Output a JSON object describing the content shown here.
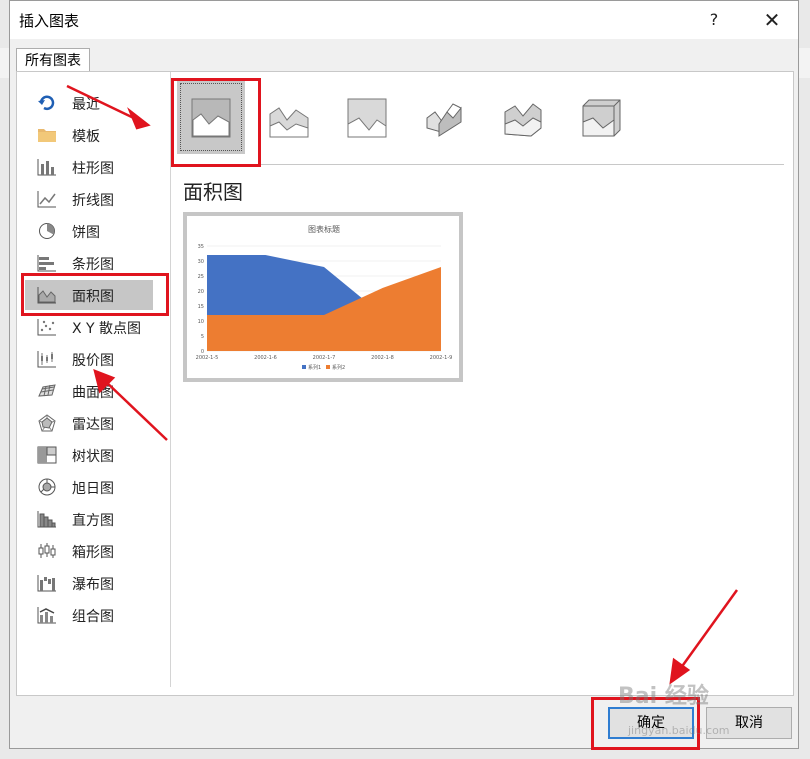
{
  "dialog": {
    "title": "插入图表",
    "help_label": "?",
    "close_label": "✕",
    "tab_label": "所有图表"
  },
  "sidebar": {
    "items": [
      {
        "label": "最近",
        "icon": "recent-icon"
      },
      {
        "label": "模板",
        "icon": "folder-icon"
      },
      {
        "label": "柱形图",
        "icon": "column-chart-icon"
      },
      {
        "label": "折线图",
        "icon": "line-chart-icon"
      },
      {
        "label": "饼图",
        "icon": "pie-chart-icon"
      },
      {
        "label": "条形图",
        "icon": "bar-chart-icon"
      },
      {
        "label": "面积图",
        "icon": "area-chart-icon",
        "selected": true
      },
      {
        "label": "X Y 散点图",
        "icon": "scatter-chart-icon"
      },
      {
        "label": "股价图",
        "icon": "stock-chart-icon"
      },
      {
        "label": "曲面图",
        "icon": "surface-chart-icon"
      },
      {
        "label": "雷达图",
        "icon": "radar-chart-icon"
      },
      {
        "label": "树状图",
        "icon": "treemap-chart-icon"
      },
      {
        "label": "旭日图",
        "icon": "sunburst-chart-icon"
      },
      {
        "label": "直方图",
        "icon": "histogram-chart-icon"
      },
      {
        "label": "箱形图",
        "icon": "box-whisker-chart-icon"
      },
      {
        "label": "瀑布图",
        "icon": "waterfall-chart-icon"
      },
      {
        "label": "组合图",
        "icon": "combo-chart-icon"
      }
    ]
  },
  "subtypes": [
    {
      "icon": "area-icon",
      "selected": true
    },
    {
      "icon": "stacked-area-icon"
    },
    {
      "icon": "100-stacked-area-icon"
    },
    {
      "icon": "3d-area-icon"
    },
    {
      "icon": "3d-stacked-area-icon"
    },
    {
      "icon": "3d-100-stacked-area-icon"
    }
  ],
  "chart_heading": "面积图",
  "chart_data": {
    "type": "area",
    "title": "图表标题",
    "categories": [
      "2002-1-5",
      "2002-1-6",
      "2002-1-7",
      "2002-1-8",
      "2002-1-9"
    ],
    "series": [
      {
        "name": "系列1",
        "values": [
          32,
          32,
          28,
          12,
          12
        ],
        "color": "#4472c4"
      },
      {
        "name": "系列2",
        "values": [
          12,
          12,
          12,
          21,
          28
        ],
        "color": "#ed7d31"
      }
    ],
    "ylim": [
      0,
      35
    ],
    "yticks": [
      "0",
      "5",
      "10",
      "15",
      "20",
      "25",
      "30",
      "35"
    ],
    "grid": true,
    "legend": "bottom"
  },
  "buttons": {
    "ok": "确定",
    "cancel": "取消"
  },
  "watermark": {
    "main": "Bai 经验",
    "sub": "jingyan.baidu.com"
  },
  "colors": {
    "annotation_red": "#e0141e",
    "accent_blue": "#2f7dd1"
  }
}
